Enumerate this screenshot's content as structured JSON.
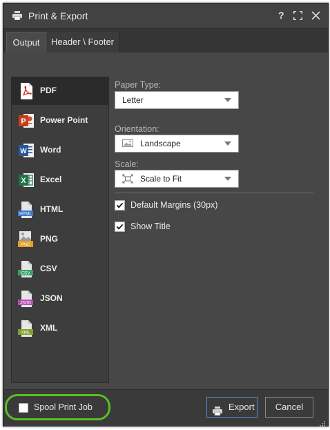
{
  "window": {
    "title": "Print & Export",
    "help_label": "?",
    "accent_color": "#4f8fd6",
    "highlight_color": "#58c020"
  },
  "tabs": [
    {
      "label": "Output",
      "active": true
    },
    {
      "label": "Header \\ Footer",
      "active": false
    }
  ],
  "formats": [
    {
      "label": "PDF",
      "icon": "pdf-icon",
      "selected": true
    },
    {
      "label": "Power Point",
      "icon": "powerpoint-icon",
      "selected": false
    },
    {
      "label": "Word",
      "icon": "word-icon",
      "selected": false
    },
    {
      "label": "Excel",
      "icon": "excel-icon",
      "selected": false
    },
    {
      "label": "HTML",
      "icon": "html-icon",
      "selected": false,
      "badge": "HTML"
    },
    {
      "label": "PNG",
      "icon": "png-icon",
      "selected": false,
      "badge": "PNG"
    },
    {
      "label": "CSV",
      "icon": "csv-icon",
      "selected": false,
      "badge": "CSV"
    },
    {
      "label": "JSON",
      "icon": "json-icon",
      "selected": false,
      "badge": "JSON"
    },
    {
      "label": "XML",
      "icon": "xml-icon",
      "selected": false,
      "badge": "XML"
    }
  ],
  "options": {
    "paper_type": {
      "label": "Paper Type:",
      "value": "Letter"
    },
    "orientation": {
      "label": "Orientation:",
      "value": "Landscape",
      "icon": "landscape-icon"
    },
    "scale": {
      "label": "Scale:",
      "value": "Scale to Fit",
      "icon": "scale-to-fit-icon"
    },
    "default_margins": {
      "label": "Default Margins (30px)",
      "checked": true
    },
    "show_title": {
      "label": "Show Title",
      "checked": true
    }
  },
  "footer": {
    "spool_label": "Spool Print Job",
    "spool_checked": false,
    "export_label": "Export",
    "cancel_label": "Cancel"
  }
}
